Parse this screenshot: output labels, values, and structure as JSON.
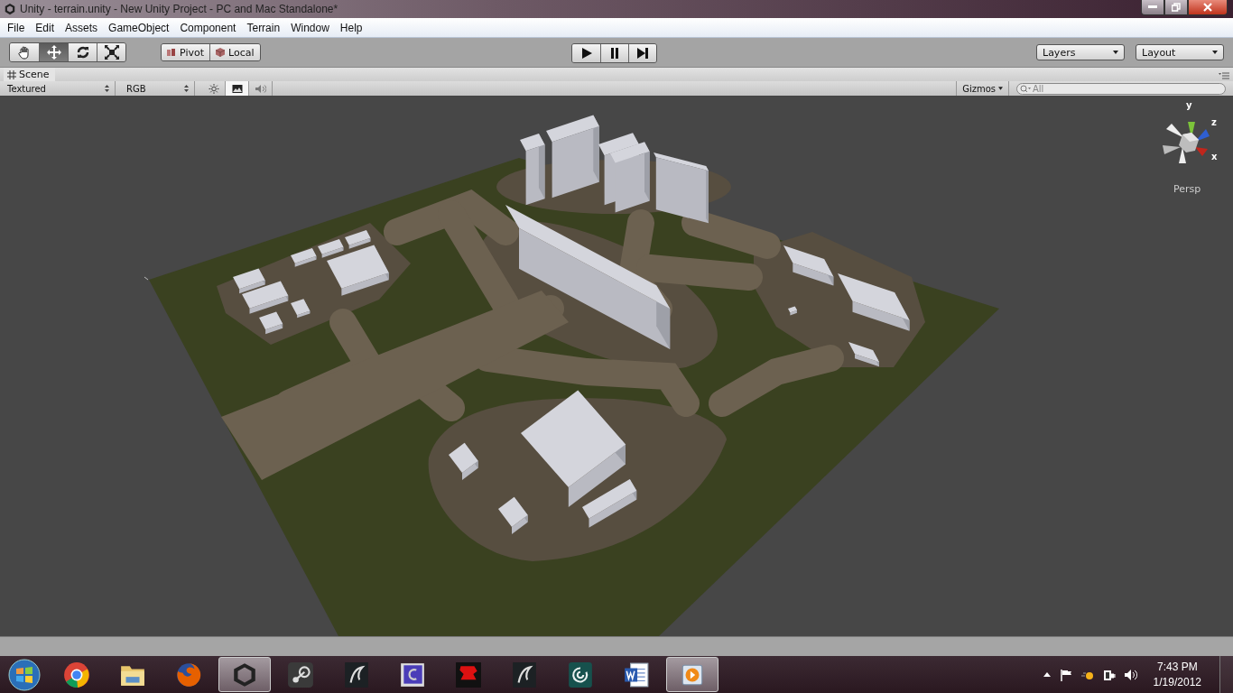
{
  "window": {
    "title": "Unity - terrain.unity - New Unity Project - PC and Mac Standalone*"
  },
  "menu": [
    "File",
    "Edit",
    "Assets",
    "GameObject",
    "Component",
    "Terrain",
    "Window",
    "Help"
  ],
  "tools": [
    {
      "kind": "hand",
      "selected": false
    },
    {
      "kind": "move",
      "selected": true
    },
    {
      "kind": "rotate",
      "selected": false
    },
    {
      "kind": "scale",
      "selected": false
    }
  ],
  "handle_buttons": [
    {
      "kind": "pivot",
      "label": "Pivot"
    },
    {
      "kind": "local",
      "label": "Local"
    }
  ],
  "playback": [
    {
      "kind": "play"
    },
    {
      "kind": "pause"
    },
    {
      "kind": "step"
    }
  ],
  "dropdowns": [
    "Layers",
    "Layout"
  ],
  "scene_tab": {
    "label": "Scene"
  },
  "scene_toolbar": {
    "draw_mode": "Textured",
    "render_mode": "RGB",
    "toggles": [
      {
        "kind": "lighting",
        "on": false
      },
      {
        "kind": "image",
        "on": true
      },
      {
        "kind": "audio",
        "on": false
      }
    ],
    "gizmos": "Gizmos",
    "search": {
      "placeholder": "All"
    }
  },
  "viewport": {
    "axis_labels": [
      "y",
      "z",
      "x"
    ],
    "projection": "Persp"
  },
  "taskbar": {
    "apps": [
      {
        "kind": "chrome",
        "active": false
      },
      {
        "kind": "folder",
        "active": false
      },
      {
        "kind": "firefox",
        "active": false
      },
      {
        "kind": "unity",
        "active": true
      },
      {
        "kind": "steam",
        "active": false
      },
      {
        "kind": "dark",
        "active": false
      },
      {
        "kind": "blue",
        "active": false
      },
      {
        "kind": "red",
        "active": false
      },
      {
        "kind": "dark",
        "active": false
      },
      {
        "kind": "teal",
        "active": false
      },
      {
        "kind": "doc",
        "active": false
      },
      {
        "kind": "media",
        "active": true
      }
    ],
    "clock": {
      "time": "7:43 PM",
      "date": "1/19/2012"
    }
  }
}
